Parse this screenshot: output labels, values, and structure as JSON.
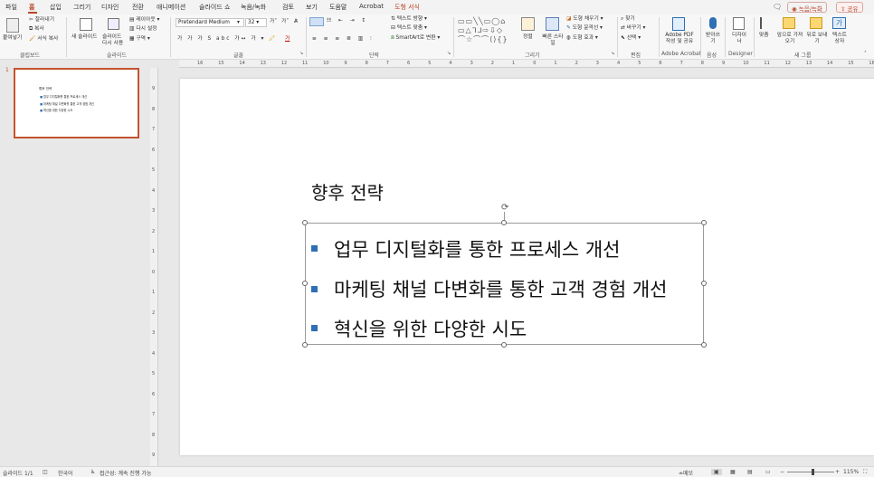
{
  "tabs": [
    "파일",
    "홈",
    "삽입",
    "그리기",
    "디자인",
    "전환",
    "애니메이션",
    "슬라이드 쇼",
    "녹음/녹화",
    "검토",
    "보기",
    "도움말",
    "Acrobat",
    "도형 서식"
  ],
  "active_tab": "홈",
  "tab_right": {
    "record": "녹음/녹화",
    "share": "공유"
  },
  "ribbon": {
    "clipboard": {
      "paste": "붙여넣기",
      "cut": "잘라내기",
      "copy": "복사",
      "format_painter": "서식 복사",
      "label": "클립보드"
    },
    "slides": {
      "new_slide": "새 슬라이드",
      "reuse": "슬라이드 다시 사용",
      "layout": "레이아웃",
      "reset": "다시 설정",
      "section": "구역",
      "label": "슬라이드"
    },
    "font": {
      "font_name": "Pretendard Medium",
      "font_size": "32",
      "label": "글꼴"
    },
    "paragraph": {
      "text_direction": "텍스트 방향",
      "align_text": "텍스트 맞춤",
      "smartart": "SmartArt로 변환",
      "label": "단락"
    },
    "drawing": {
      "arrange": "정렬",
      "quick_styles": "빠른 스타일",
      "fill": "도형 채우기",
      "outline": "도형 윤곽선",
      "effects": "도형 효과",
      "label": "그리기"
    },
    "editing": {
      "find": "찾기",
      "replace": "바꾸기",
      "select": "선택",
      "label": "편집"
    },
    "acrobat": {
      "create_pdf": "Adobe PDF 작성 및 공유",
      "label": "Adobe Acrobat"
    },
    "voice": {
      "dictate": "받아쓰기",
      "label": "음성"
    },
    "designer": {
      "designer": "디자이너",
      "label": "Designer"
    },
    "arrange_group": {
      "align": "맞춤",
      "bring_forward": "앞으로 가져오기",
      "send_backward": "뒤로 보내기",
      "text_box": "텍스트 상자",
      "label": "새 그룹"
    }
  },
  "ruler_h": [
    "16",
    "15",
    "14",
    "13",
    "12",
    "11",
    "10",
    "9",
    "8",
    "7",
    "6",
    "5",
    "4",
    "3",
    "2",
    "1",
    "0",
    "1",
    "2",
    "3",
    "4",
    "5",
    "6",
    "7",
    "8",
    "9",
    "10",
    "11",
    "12",
    "13",
    "14",
    "15",
    "16"
  ],
  "ruler_v": [
    "9",
    "8",
    "7",
    "6",
    "5",
    "4",
    "3",
    "2",
    "1",
    "0",
    "1",
    "2",
    "3",
    "4",
    "5",
    "6",
    "7",
    "8",
    "9"
  ],
  "thumbnail": {
    "number": "1",
    "title": "향후 전략",
    "bullets": [
      "업무 디지털화를 통한 프로세스 개선",
      "마케팅 채널 다변화를 통한 고객 경험 개선",
      "혁신을 위한 다양한 시도"
    ]
  },
  "slide": {
    "title": "향후 전략",
    "bullets": [
      "업무 디지털화를 통한 프로세스 개선",
      "마케팅 채널 다변화를 통한 고객 경험 개선",
      "혁신을 위한 다양한 시도"
    ]
  },
  "status": {
    "slide_count": "슬라이드 1/1",
    "language": "한국어",
    "accessibility": "접근성: 계속 진행 가능",
    "notes": "메모",
    "zoom": "115%"
  },
  "colors": {
    "accent": "#b7472a",
    "bullet": "#2f6fb3",
    "thumb_border": "#c4532f"
  }
}
